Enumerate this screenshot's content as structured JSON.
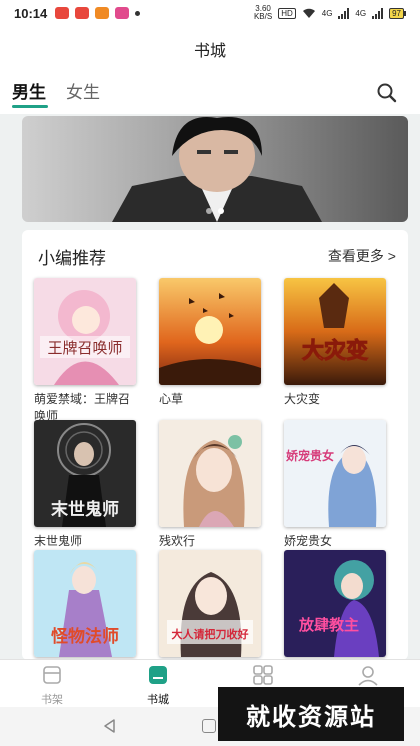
{
  "status_bar": {
    "time": "10:14",
    "speed_value": "3.60",
    "speed_unit": "KB/S",
    "hd": "HD",
    "net_a": "4G",
    "net_b": "4G",
    "battery": "97"
  },
  "header": {
    "title": "书城"
  },
  "tabs": [
    {
      "label": "男生",
      "active": true
    },
    {
      "label": "女生",
      "active": false
    }
  ],
  "banner": {
    "dots_count": 2,
    "active_dot": 1
  },
  "section": {
    "title": "小编推荐",
    "more": "查看更多 >"
  },
  "books": [
    {
      "title": "萌爱禁域：王牌召唤师",
      "cover_text": "王牌召唤师"
    },
    {
      "title": "心草",
      "cover_text": ""
    },
    {
      "title": "大灾变",
      "cover_text": "大灾变"
    },
    {
      "title": "末世鬼师",
      "cover_text": "末世鬼师"
    },
    {
      "title": "残欢行",
      "cover_text": ""
    },
    {
      "title": "娇宠贵女",
      "cover_text": "娇宠贵女"
    },
    {
      "title": "",
      "cover_text": "怪物法师"
    },
    {
      "title": "",
      "cover_text": "大人请把刀收好"
    },
    {
      "title": "",
      "cover_text": "放肆教主"
    }
  ],
  "bottom_nav": [
    {
      "label": "书架",
      "icon": "bookshelf-icon",
      "active": false
    },
    {
      "label": "书城",
      "icon": "bookstore-icon",
      "active": true
    },
    {
      "label": "",
      "icon": "category-icon",
      "active": false
    },
    {
      "label": "",
      "icon": "profile-icon",
      "active": false
    }
  ],
  "watermark": "就收资源站",
  "colors": {
    "accent": "#1fa187",
    "page_bg": "#eef1f1"
  }
}
